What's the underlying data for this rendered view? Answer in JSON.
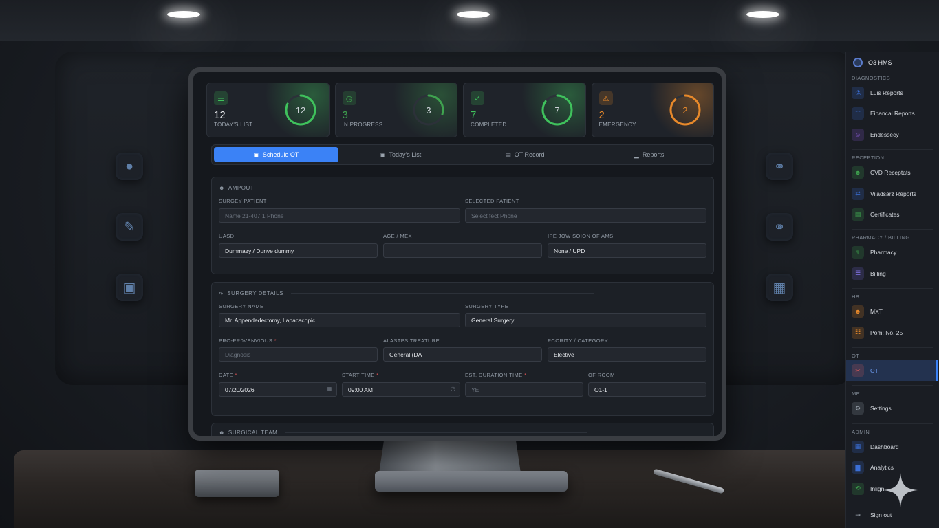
{
  "stats": [
    {
      "value": "12",
      "label": "TODAY'S LIST",
      "ring": "12",
      "color": "#3fc25c",
      "progress": 0.82,
      "icon": "list-icon"
    },
    {
      "value": "3",
      "label": "IN PROGRESS",
      "ring": "3",
      "color": "#3fa34f",
      "progress": 0.3,
      "icon": "clock-icon"
    },
    {
      "value": "7",
      "label": "COMPLETED",
      "ring": "7",
      "color": "#3fc25c",
      "progress": 0.85,
      "icon": "check-icon"
    },
    {
      "value": "2",
      "label": "EMERGENCY",
      "ring": "2",
      "color": "#e8892a",
      "progress": 0.88,
      "icon": "alert-icon"
    }
  ],
  "tabs": [
    {
      "label": "Schedule OT",
      "active": true
    },
    {
      "label": "Today's List",
      "active": false
    },
    {
      "label": "OT Record",
      "active": false
    },
    {
      "label": "Reports",
      "active": false
    }
  ],
  "patient": {
    "title": "AMPOUT",
    "surgery_patient_label": "SURGEY PATIENT",
    "surgery_patient_placeholder": "Name 21-407 1 Phone",
    "selected_patient_label": "SELECTED PATIENT",
    "selected_patient_placeholder": "Select fect Phone",
    "uasd_label": "UASD",
    "uasd_value": "Dummazy / Dunve dummy",
    "age_label": "AGE / MEX",
    "age_value": "",
    "ipe_label": "IPE JOW SOION OF AMS",
    "ipe_value": "None / UPD"
  },
  "surgery": {
    "title": "SURGERY DETAILS",
    "name_label": "SURGERY NAME",
    "name_value": "Mr. Appendedectomy, Lapacscopic",
    "type_label": "SURGERY TYPE",
    "type_value": "General Surgery",
    "pro_label": "PRO-PR0VENVIOUS",
    "pro_placeholder": "Diagnosis",
    "alast_label": "ALASTPS TREATURE",
    "alast_value": "General (DA",
    "priority_label": "PCORITY / CATEGORY",
    "priority_value": "Elective",
    "date_label": "DATE",
    "date_value": "07/20/2026",
    "start_label": "START TIME",
    "start_value": "09:00 AM",
    "duration_label": "EST. DURATION TIME",
    "duration_placeholder": "YE",
    "room_label": "OF ROOM",
    "room_value": "O1-1"
  },
  "team": {
    "title": "SURGICAL TEAM"
  },
  "sidebar": {
    "brand": "O3 HMS",
    "sections": [
      {
        "title": "DIAGNOSTICS",
        "items": [
          {
            "label": "Luis Reports",
            "icon": "flask-icon",
            "color": "#3b6fd6"
          },
          {
            "label": "Einancal Reports",
            "icon": "file-icon",
            "color": "#3b6fd6"
          },
          {
            "label": "Endessecy",
            "icon": "user-icon",
            "color": "#8a5bd6"
          }
        ]
      },
      {
        "title": "RECEPTION",
        "items": [
          {
            "label": "CVD Receptats",
            "icon": "people-icon",
            "color": "#3fa34f"
          },
          {
            "label": "Viladsarz Reports",
            "icon": "transfer-icon",
            "color": "#3b6fd6"
          },
          {
            "label": "Certificates",
            "icon": "certificate-icon",
            "color": "#3fa34f"
          }
        ]
      },
      {
        "title": "PHARMACY / BILLING",
        "items": [
          {
            "label": "Pharmacy",
            "icon": "pill-icon",
            "color": "#3fa34f"
          },
          {
            "label": "Billing",
            "icon": "receipt-icon",
            "color": "#7a6bd6"
          }
        ]
      },
      {
        "title": "HB",
        "items": [
          {
            "label": "MXT",
            "icon": "team-icon",
            "color": "#e8892a"
          },
          {
            "label": "Pom: No. 25",
            "icon": "doc-icon",
            "color": "#e8892a"
          }
        ]
      },
      {
        "title": "OT",
        "items": [
          {
            "label": "OT",
            "icon": "scalpel-icon",
            "color": "#d65b5b",
            "active": true
          }
        ]
      },
      {
        "title": "ME",
        "items": [
          {
            "label": "Settings",
            "icon": "gear-icon",
            "color": "#9aa3ad"
          }
        ]
      },
      {
        "title": "ADMIN",
        "items": [
          {
            "label": "Dashboard",
            "icon": "dashboard-icon",
            "color": "#3b6fd6"
          },
          {
            "label": "Analytics",
            "icon": "chart-icon",
            "color": "#3b6fd6"
          },
          {
            "label": "Inlign",
            "icon": "history-icon",
            "color": "#3fa34f"
          }
        ]
      }
    ],
    "signout": "Sign out"
  }
}
